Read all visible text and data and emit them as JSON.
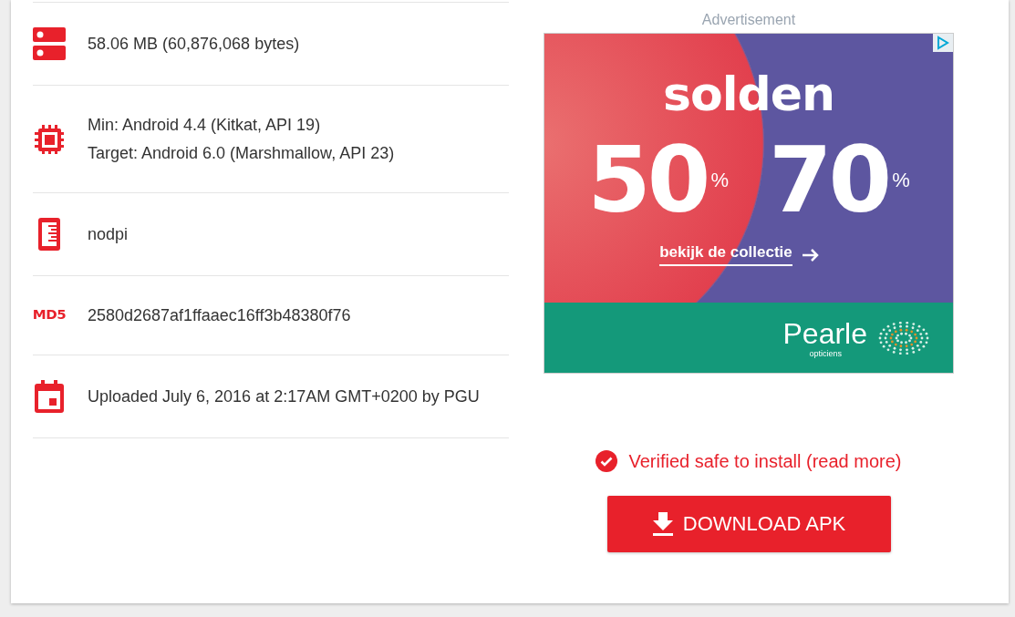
{
  "details": [
    {
      "kind": "storage",
      "lines": [
        "58.06 MB (60,876,068 bytes)"
      ]
    },
    {
      "kind": "cpu",
      "lines": [
        "Min: Android 4.4 (Kitkat, API 19)",
        "Target: Android 6.0 (Marshmallow, API 23)"
      ]
    },
    {
      "kind": "screen",
      "lines": [
        "nodpi"
      ]
    },
    {
      "kind": "md5",
      "icon_text": "MD5",
      "lines": [
        "2580d2687af1ffaaec16ff3b48380f76"
      ]
    },
    {
      "kind": "calendar",
      "lines": [
        "Uploaded July 6, 2016 at 2:17AM GMT+0200 by PGU"
      ]
    }
  ],
  "advertisement": {
    "label": "Advertisement",
    "headline": "solden",
    "discounts": [
      {
        "value": "50",
        "unit": "%"
      },
      {
        "value": "70",
        "unit": "%"
      }
    ],
    "link": "bekijk de collectie",
    "brand": "Pearle",
    "brand_sub": "opticiens"
  },
  "verified": {
    "text": "Verified safe to install (read more)"
  },
  "download": {
    "label": "DOWNLOAD APK"
  }
}
